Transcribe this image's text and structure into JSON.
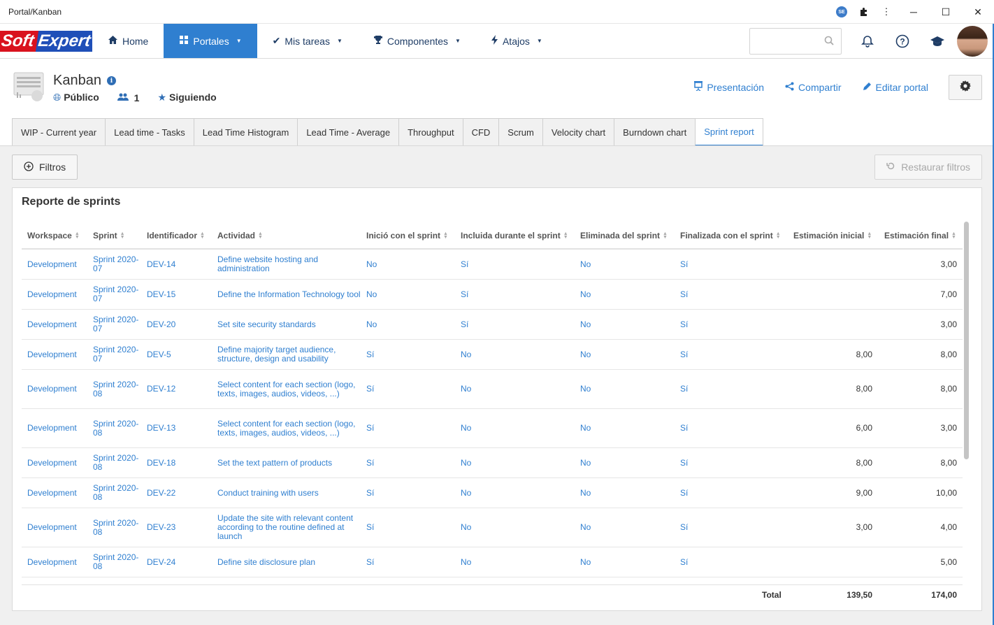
{
  "window": {
    "title": "Portal/Kanban",
    "badge": "SE"
  },
  "nav": {
    "brand_soft": "Soft",
    "brand_expert": "Expert",
    "items": [
      {
        "label": "Home",
        "icon": "home-icon",
        "caret": false,
        "active": false
      },
      {
        "label": "Portales",
        "icon": "portals-icon",
        "caret": true,
        "active": true
      },
      {
        "label": "Mis tareas",
        "icon": "check-icon",
        "caret": true,
        "active": false
      },
      {
        "label": "Componentes",
        "icon": "trophy-icon",
        "caret": true,
        "active": false
      },
      {
        "label": "Atajos",
        "icon": "bolt-icon",
        "caret": true,
        "active": false
      }
    ],
    "search_value": ""
  },
  "header": {
    "title": "Kanban",
    "visibility": "Público",
    "followers": "1",
    "follow_status": "Siguiendo",
    "actions": {
      "presentation": "Presentación",
      "share": "Compartir",
      "edit": "Editar portal"
    }
  },
  "tabs": [
    {
      "label": "WIP - Current year",
      "active": false
    },
    {
      "label": "Lead time - Tasks",
      "active": false
    },
    {
      "label": "Lead Time Histogram",
      "active": false
    },
    {
      "label": "Lead Time - Average",
      "active": false
    },
    {
      "label": "Throughput",
      "active": false
    },
    {
      "label": "CFD",
      "active": false
    },
    {
      "label": "Scrum",
      "active": false
    },
    {
      "label": "Velocity chart",
      "active": false
    },
    {
      "label": "Burndown chart",
      "active": false
    },
    {
      "label": "Sprint report",
      "active": true
    }
  ],
  "toolbar": {
    "filters_label": "Filtros",
    "restore_label": "Restaurar filtros"
  },
  "report": {
    "title": "Reporte de sprints",
    "columns": [
      "Workspace",
      "Sprint",
      "Identificador",
      "Actividad",
      "Inició con el sprint",
      "Incluida durante el sprint",
      "Eliminada del sprint",
      "Finalizada con el sprint",
      "Estimación inicial",
      "Estimación final"
    ],
    "rows": [
      {
        "workspace": "Development",
        "sprint": "Sprint 2020-07",
        "id": "DEV-14",
        "activity": "Define website hosting and administration",
        "started": "No",
        "included": "Sí",
        "removed": "No",
        "finished": "Sí",
        "est_initial": "",
        "est_final": "3,00"
      },
      {
        "workspace": "Development",
        "sprint": "Sprint 2020-07",
        "id": "DEV-15",
        "activity": "Define the Information Technology tool",
        "started": "No",
        "included": "Sí",
        "removed": "No",
        "finished": "Sí",
        "est_initial": "",
        "est_final": "7,00"
      },
      {
        "workspace": "Development",
        "sprint": "Sprint 2020-07",
        "id": "DEV-20",
        "activity": "Set site security standards",
        "started": "No",
        "included": "Sí",
        "removed": "No",
        "finished": "Sí",
        "est_initial": "",
        "est_final": "3,00"
      },
      {
        "workspace": "Development",
        "sprint": "Sprint 2020-07",
        "id": "DEV-5",
        "activity": "Define majority target audience, structure, design and usability",
        "started": "Sí",
        "included": "No",
        "removed": "No",
        "finished": "Sí",
        "est_initial": "8,00",
        "est_final": "8,00"
      },
      {
        "workspace": "Development",
        "sprint": "Sprint 2020-08",
        "id": "DEV-12",
        "activity": "Select content for each section (logo, texts, images, audios, videos, ...)",
        "started": "Sí",
        "included": "No",
        "removed": "No",
        "finished": "Sí",
        "est_initial": "8,00",
        "est_final": "8,00"
      },
      {
        "workspace": "Development",
        "sprint": "Sprint 2020-08",
        "id": "DEV-13",
        "activity": "Select content for each section (logo, texts, images, audios, videos, ...)",
        "started": "Sí",
        "included": "No",
        "removed": "No",
        "finished": "Sí",
        "est_initial": "6,00",
        "est_final": "3,00"
      },
      {
        "workspace": "Development",
        "sprint": "Sprint 2020-08",
        "id": "DEV-18",
        "activity": "Set the text pattern of products",
        "started": "Sí",
        "included": "No",
        "removed": "No",
        "finished": "Sí",
        "est_initial": "8,00",
        "est_final": "8,00"
      },
      {
        "workspace": "Development",
        "sprint": "Sprint 2020-08",
        "id": "DEV-22",
        "activity": "Conduct training with users",
        "started": "Sí",
        "included": "No",
        "removed": "No",
        "finished": "Sí",
        "est_initial": "9,00",
        "est_final": "10,00"
      },
      {
        "workspace": "Development",
        "sprint": "Sprint 2020-08",
        "id": "DEV-23",
        "activity": "Update the site with relevant content according to the routine defined at launch",
        "started": "Sí",
        "included": "No",
        "removed": "No",
        "finished": "Sí",
        "est_initial": "3,00",
        "est_final": "4,00"
      },
      {
        "workspace": "Development",
        "sprint": "Sprint 2020-08",
        "id": "DEV-24",
        "activity": "Define site disclosure plan",
        "started": "Sí",
        "included": "No",
        "removed": "No",
        "finished": "Sí",
        "est_initial": "",
        "est_final": "5,00"
      }
    ],
    "total_label": "Total",
    "total_initial": "139,50",
    "total_final": "174,00"
  },
  "colors": {
    "accent": "#2f7fd0",
    "nav_text": "#1f3d66",
    "brand_red": "#d9121e",
    "brand_blue": "#1f4fb8"
  }
}
